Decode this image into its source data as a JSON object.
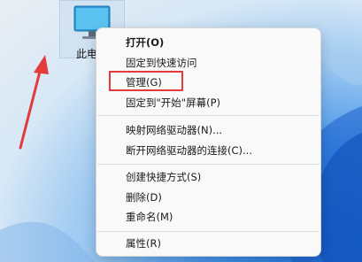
{
  "desktop": {
    "icon": {
      "label": "此电",
      "icon_name": "monitor-icon"
    }
  },
  "context_menu": {
    "items": [
      {
        "label": "打开(O)",
        "bold": true
      },
      {
        "label": "固定到快速访问"
      },
      {
        "label": "管理(G)",
        "highlighted": true
      },
      {
        "label": "固定到\"开始\"屏幕(P)"
      },
      {
        "label": "映射网络驱动器(N)..."
      },
      {
        "label": "断开网络驱动器的连接(C)..."
      },
      {
        "label": "创建快捷方式(S)"
      },
      {
        "label": "删除(D)"
      },
      {
        "label": "重命名(M)"
      },
      {
        "label": "属性(R)"
      }
    ]
  },
  "colors": {
    "highlight_border": "#e23b3b",
    "arrow": "#e23b3b",
    "menu_background": "#f9f9f9",
    "wallpaper_accent": "#1f6fd8"
  }
}
